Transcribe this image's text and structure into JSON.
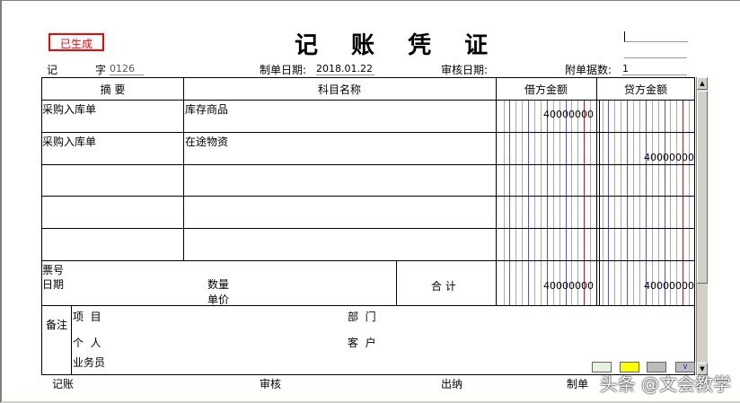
{
  "status_badge": "已生成",
  "title": "记 账 凭 证",
  "header": {
    "voucher_type": "记",
    "voucher_word": "字",
    "voucher_no": "0126",
    "date_label": "制单日期:",
    "date_value": "2018.01.22",
    "audit_date_label": "审核日期:",
    "audit_date_value": "",
    "attachments_label": "附单据数:",
    "attachments_value": "1"
  },
  "columns": {
    "summary": "摘 要",
    "account": "科目名称",
    "debit": "借方金额",
    "credit": "贷方金额"
  },
  "rows": [
    {
      "summary": "采购入库单",
      "account": "库存商品",
      "debit": "40000000",
      "credit": ""
    },
    {
      "summary": "采购入库单",
      "account": "在途物资",
      "debit": "",
      "credit": "40000000"
    },
    {
      "summary": "",
      "account": "",
      "debit": "",
      "credit": ""
    },
    {
      "summary": "",
      "account": "",
      "debit": "",
      "credit": ""
    },
    {
      "summary": "",
      "account": "",
      "debit": "",
      "credit": ""
    }
  ],
  "totals": {
    "ticket_label": "票号",
    "date_label": "日期",
    "qty_label": "数量",
    "price_label": "单价",
    "total_label": "合 计",
    "debit": "40000000",
    "credit": "40000000"
  },
  "notes": {
    "label": "备注",
    "project": "项  目",
    "dept": "部  门",
    "person": "个  人",
    "customer": "客  户",
    "salesman": "业务员"
  },
  "footer": {
    "bookkeeper": "记账",
    "auditor": "审核",
    "cashier": "出纳",
    "preparer": "制单"
  },
  "watermark": "头条 @文会教学",
  "colors": {
    "status": "#ff0000",
    "grid_blue": "#5050ff",
    "grid_red": "#ff0000"
  }
}
